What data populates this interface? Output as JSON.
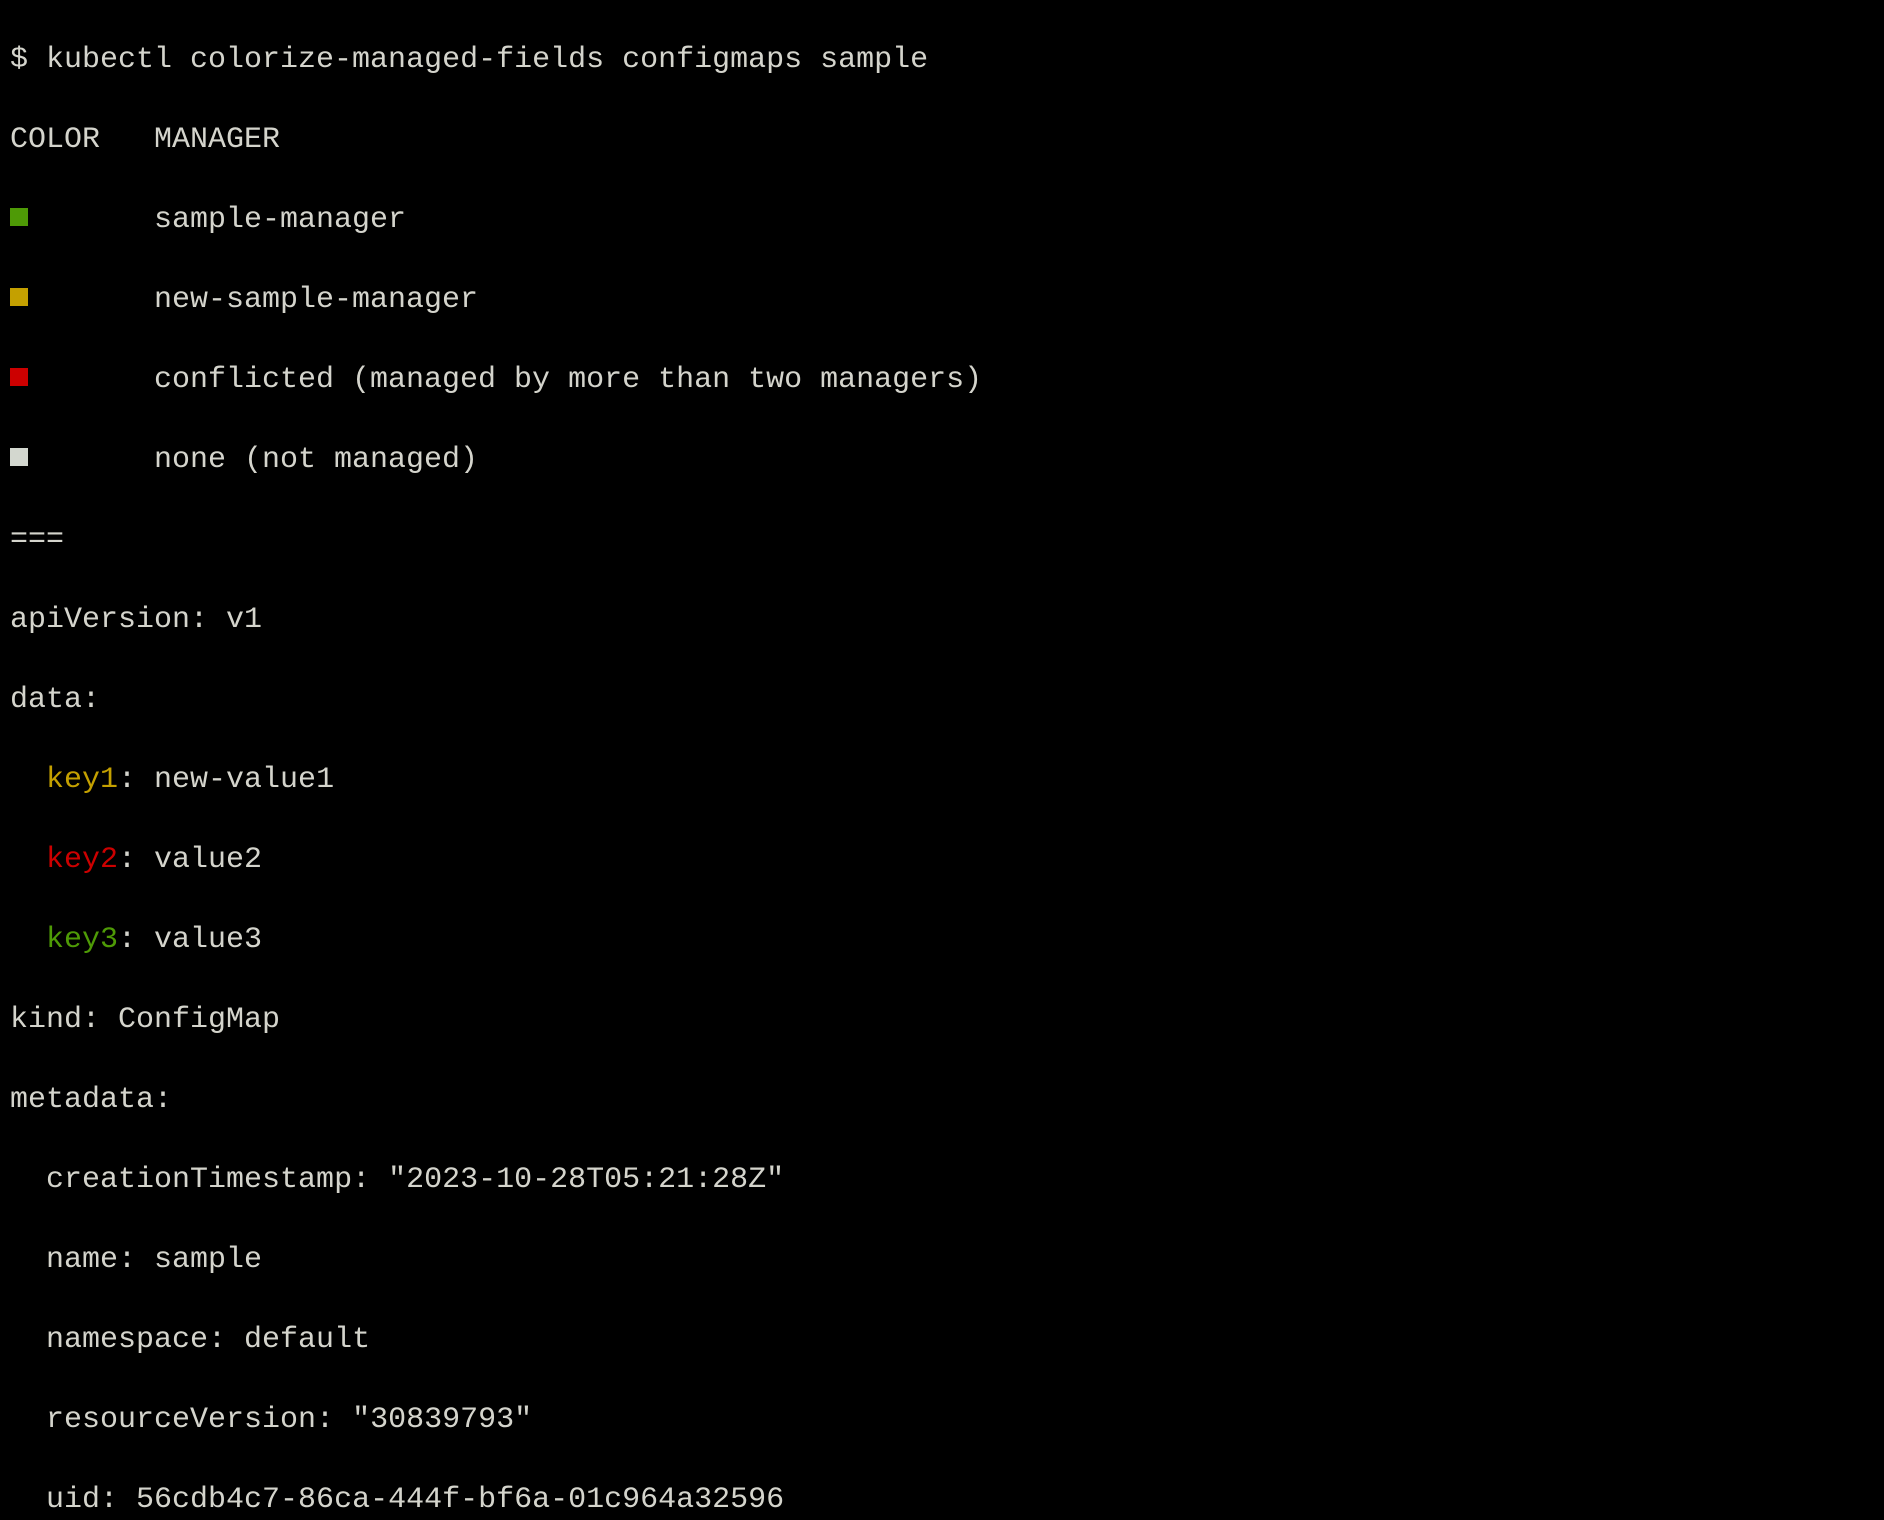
{
  "command": "$ kubectl colorize-managed-fields configmaps sample",
  "legend": {
    "headers": [
      "COLOR",
      "MANAGER"
    ],
    "rows": [
      {
        "color": "#4e9a06",
        "label": "sample-manager"
      },
      {
        "color": "#c4a000",
        "label": "new-sample-manager"
      },
      {
        "color": "#cc0000",
        "label": "conflicted (managed by more than two managers)"
      },
      {
        "color": "#d3d7cf",
        "label": "none (not managed)"
      }
    ]
  },
  "separator": "===",
  "yaml": {
    "apiVersion": "apiVersion: v1",
    "data": "data:",
    "data_items": [
      {
        "key": "key1",
        "rest": ": new-value1",
        "color": "#c4a000"
      },
      {
        "key": "key2",
        "rest": ": value2",
        "color": "#cc0000"
      },
      {
        "key": "key3",
        "rest": ": value3",
        "color": "#4e9a06"
      }
    ],
    "kind": "kind: ConfigMap",
    "metadata": "metadata:",
    "metadata_items": [
      "creationTimestamp: \"2023-10-28T05:21:28Z\"",
      "name: sample",
      "namespace: default",
      "resourceVersion: \"30839793\"",
      "uid: 56cdb4c7-86ca-444f-bf6a-01c964a32596"
    ]
  }
}
